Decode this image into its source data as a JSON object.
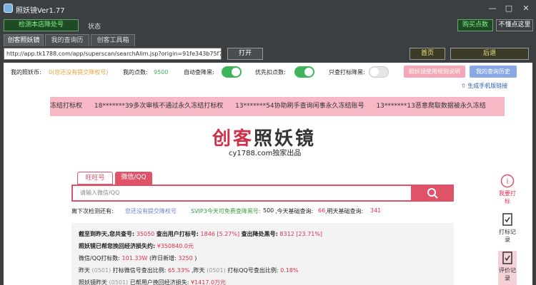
{
  "window": {
    "title": "照妖镜Ver1.77",
    "buttons": [
      "—",
      "□",
      "✕"
    ]
  },
  "toolbar": {
    "check_button": "检测本店降处号",
    "status_label": "状态",
    "buy_points": "购买点数",
    "free_points": "不懂点这里"
  },
  "tabs": [
    "创客照妖镜",
    "我的查询历",
    "创客工具箱"
  ],
  "address": {
    "url": "http://app.tk1788.com/app/superscan/searchAlim.jsp?origin=91fe343b75f77",
    "open": "打开",
    "home": "首页",
    "back": "后退"
  },
  "account": {
    "coins_label": "我的照妖币:",
    "coins_value": "0(您还没有提交降权号)",
    "points_label": "我的点数:",
    "points_value": "9500",
    "auto_label": "自动查降黑:",
    "priority_label": "优先扣点数:",
    "only_label": "只查打标降黑:",
    "guide_btn": "照妖镜使用规则说明",
    "history_btn": "我的查询历史",
    "mobile_link": "生成手机版链接"
  },
  "ticker": [
    "冻结打标权",
    "18*******39多次审核不通过永久冻结打标权",
    "13*******54协助刷手查询闲事永久冻结账号",
    "13*******13恶意爬取数据被永久冻结"
  ],
  "logo": {
    "a": "创客",
    "b": "照妖镜",
    "subtitle": "cy1788.com独家出品"
  },
  "search": {
    "tab1": "旺旺号",
    "tab2": "微信/QQ",
    "placeholder": "请输入微信/QQ"
  },
  "reward": {
    "label": "离下次检测还有:",
    "link": "您还没有提交降权号",
    "svip": "SVIP3今天可免费查降黑号:",
    "svip_val": "500",
    "used_label": ",今天基础查询:",
    "used_val": "66",
    "base_label": ",明天基础查询:",
    "base_val": "341"
  },
  "stats": {
    "l1_a": "截至到昨天,您共查号:",
    "l1_b": "35050",
    "l1_c": "查出用户打标号:",
    "l1_d": "1846 [5.27%]",
    "l1_e": "查出降处黑号:",
    "l1_f": "8312 [23.71%]",
    "l2_a": "照妖镜已帮您挽回经济损失约:",
    "l2_b": "¥350840.0元",
    "l3_a": "微信/QQ打标数:",
    "l3_b": "101.33W",
    "l3_c": "(昨日新增:",
    "l3_d": "3250",
    "l3_e": ")",
    "l4_a": "昨天",
    "l4_b": "(0501)",
    "l4_c": "打标微信号查出比例:",
    "l4_d": "65.33%",
    "l4_e": ",昨天",
    "l4_f": "(0501)",
    "l4_g": "打标QQ号查出比例:",
    "l4_h": "0.18%",
    "l5_a": "照妖镜昨天",
    "l5_b": "(0501)",
    "l5_c": "已帮用户挽回经济损失:",
    "l5_d": "¥1417.0万元"
  },
  "side": {
    "s1": "我要打标",
    "s2": "打标记录",
    "s3": "评价记录"
  },
  "colors": {
    "accent": "#e05268",
    "green": "#3db45a",
    "ticker_bg": "#f6b8c5"
  }
}
